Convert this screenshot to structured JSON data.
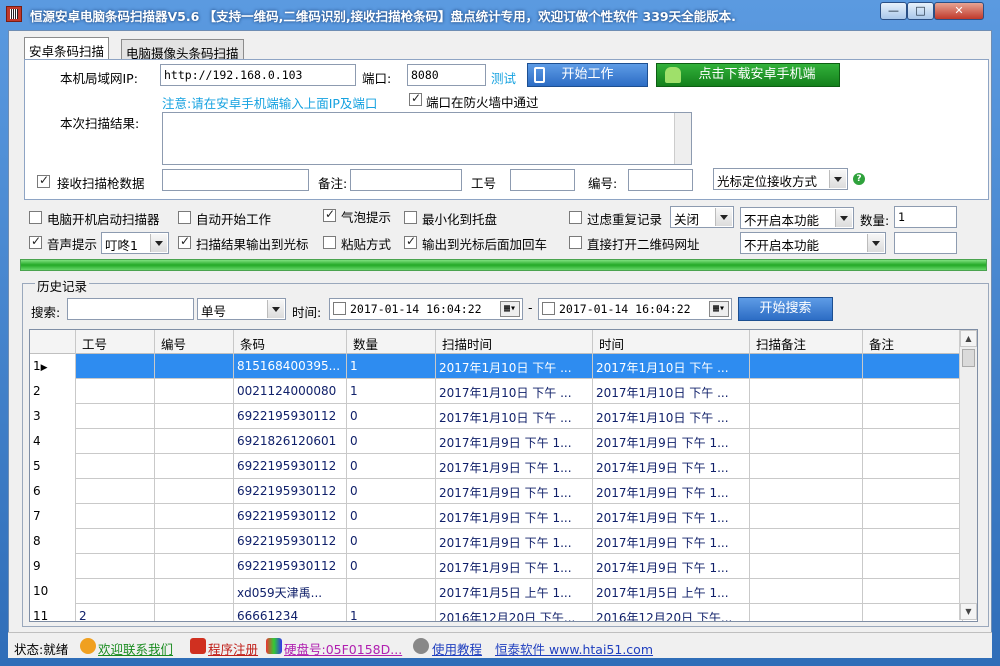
{
  "window": {
    "title": "恒源安卓电脑条码扫描器V5.6 【支持一维码,二维码识别,接收扫描枪条码】盘点统计专用，欢迎订做个性软件 339天全能版本.",
    "min_label": "—",
    "max_label": "□",
    "close_label": "✕"
  },
  "tabs": [
    {
      "label": "安卓条码扫描",
      "active": true
    },
    {
      "label": "电脑摄像头条码扫描",
      "active": false
    }
  ],
  "connect": {
    "ip_label": "本机局域网IP:",
    "ip_value": "http://192.168.0.103",
    "port_label": "端口:",
    "port_value": "8080",
    "test_label": "测试",
    "start_label": "开始工作",
    "download_label": "点击下载安卓手机端",
    "note": "注意:请在安卓手机端输入上面IP及端口",
    "firewall_label": "端口在防火墙中通过",
    "result_label": "本次扫描结果:",
    "result_value": ""
  },
  "scanner": {
    "receive_label": "接收扫描枪数据",
    "remark_label": "备注:",
    "worker_label": "工号",
    "number_label": "编号:",
    "mode_value": "光标定位接收方式",
    "help_icon": "?"
  },
  "options": {
    "autostart_label": "电脑开机启动扫描器",
    "autowork_label": "自动开始工作",
    "bubble_label": "气泡提示",
    "tray_label": "最小化到托盘",
    "filter_label": "过虑重复记录",
    "filter_value": "关闭",
    "feature1_value": "不开启本功能",
    "qty_label": "数量:",
    "qty_value": "1",
    "sound_label": "音声提示",
    "sound_value": "叮咚1",
    "output_label": "扫描结果输出到光标",
    "paste_label": "粘贴方式",
    "enter_label": "输出到光标后面加回车",
    "qrurl_label": "直接打开二维码网址",
    "feature2_value": "不开启本功能"
  },
  "history": {
    "title": "历史记录",
    "search_label": "搜索:",
    "field_value": "单号",
    "time_label": "时间:",
    "date_from": "2017-01-14  16:04:22",
    "date_sep": "-",
    "date_to": "2017-01-14  16:04:22",
    "search_button": "开始搜索"
  },
  "table": {
    "headers": [
      "",
      "工号",
      "编号",
      "条码",
      "数量",
      "扫描时间",
      "时间",
      "扫描备注",
      "备注"
    ],
    "rows": [
      [
        "1",
        "",
        "",
        "815168400395...",
        "1",
        "2017年1月10日 下午 ...",
        "2017年1月10日 下午 ...",
        "",
        ""
      ],
      [
        "2",
        "",
        "",
        "0021124000080",
        "1",
        "2017年1月10日 下午 ...",
        "2017年1月10日 下午 ...",
        "",
        ""
      ],
      [
        "3",
        "",
        "",
        "6922195930112",
        "0",
        "2017年1月10日 下午 ...",
        "2017年1月10日 下午 ...",
        "",
        ""
      ],
      [
        "4",
        "",
        "",
        "6921826120601",
        "0",
        "2017年1月9日 下午 1...",
        "2017年1月9日 下午 1...",
        "",
        ""
      ],
      [
        "5",
        "",
        "",
        "6922195930112",
        "0",
        "2017年1月9日 下午 1...",
        "2017年1月9日 下午 1...",
        "",
        ""
      ],
      [
        "6",
        "",
        "",
        "6922195930112",
        "0",
        "2017年1月9日 下午 1...",
        "2017年1月9日 下午 1...",
        "",
        ""
      ],
      [
        "7",
        "",
        "",
        "6922195930112",
        "0",
        "2017年1月9日 下午 1...",
        "2017年1月9日 下午 1...",
        "",
        ""
      ],
      [
        "8",
        "",
        "",
        "6922195930112",
        "0",
        "2017年1月9日 下午 1...",
        "2017年1月9日 下午 1...",
        "",
        ""
      ],
      [
        "9",
        "",
        "",
        "6922195930112",
        "0",
        "2017年1月9日 下午 1...",
        "2017年1月9日 下午 1...",
        "",
        ""
      ],
      [
        "10",
        "",
        "",
        "xd059天津禹...",
        "",
        "2017年1月5日 上午 1...",
        "2017年1月5日 上午 1...",
        "",
        ""
      ],
      [
        "11",
        "2",
        "",
        "66661234",
        "1",
        "2016年12月20日 下午...",
        "2016年12月20日 下午...",
        "",
        ""
      ]
    ]
  },
  "status": {
    "state": "状态:就绪",
    "contact": "欢迎联系我们",
    "register": "程序注册",
    "disk": "硬盘号:05F0158D...",
    "tutorial": "使用教程",
    "site": "恒泰软件 www.htai51.com"
  },
  "colors": {
    "title_bar": "#3a78c8",
    "selected_row": "#2e8cf0",
    "progress_green": "#23a826",
    "link_blue": "#1f3fbf"
  }
}
